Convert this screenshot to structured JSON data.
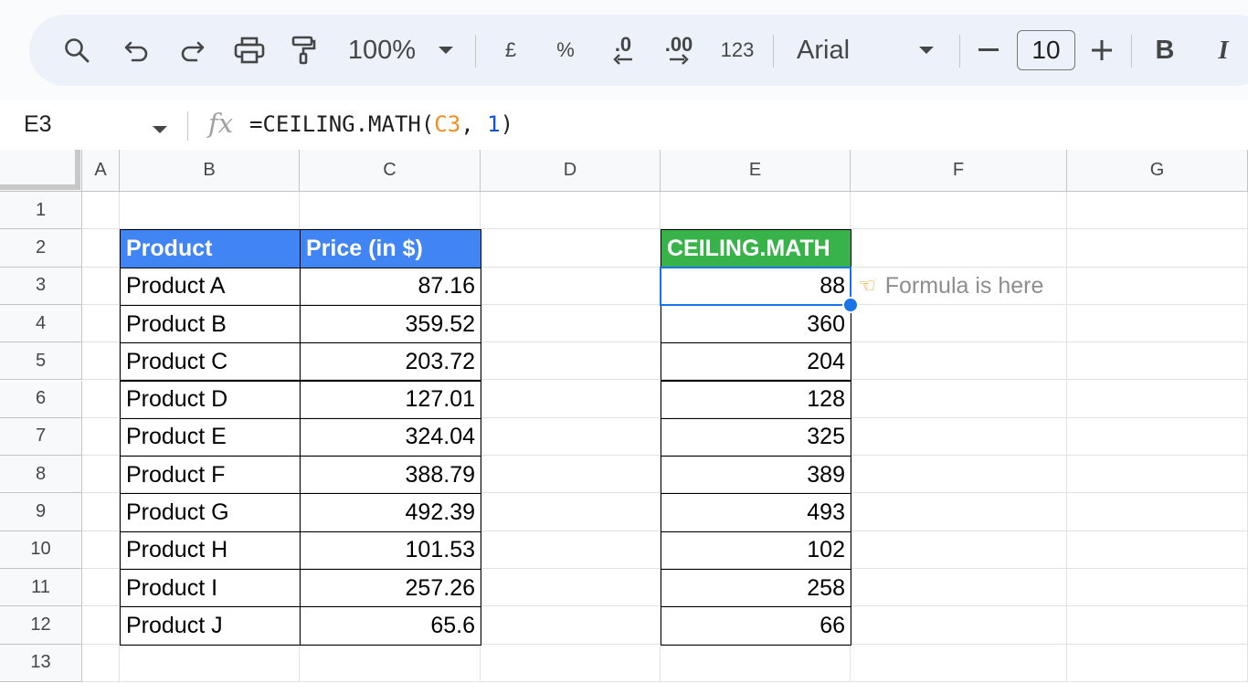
{
  "toolbar": {
    "zoom": "100%",
    "currency_symbol": "£",
    "percent_symbol": "%",
    "decrease_decimal": ".0",
    "increase_decimal": ".00",
    "number_format": "123",
    "font_family": "Arial",
    "font_size": "10",
    "bold": "B",
    "italic": "I",
    "icons": [
      "search-icon",
      "undo-icon",
      "redo-icon",
      "print-icon",
      "paint-format-icon",
      "chevron-down-icon",
      "minus-icon",
      "plus-icon"
    ]
  },
  "formula_bar": {
    "name_box": "E3",
    "fx_label": "fx",
    "formula_prefix": "=CEILING.MATH(",
    "formula_ref": "C3",
    "formula_sep": ", ",
    "formula_arg": "1",
    "formula_suffix": ")"
  },
  "columns": [
    "A",
    "B",
    "C",
    "D",
    "E",
    "F",
    "G"
  ],
  "rows": [
    "1",
    "2",
    "3",
    "4",
    "5",
    "6",
    "7",
    "8",
    "9",
    "10",
    "11",
    "12",
    "13"
  ],
  "table": {
    "header_product": "Product",
    "header_price": "Price (in $)",
    "products": [
      "Product A",
      "Product B",
      "Product C",
      "Product D",
      "Product E",
      "Product F",
      "Product G",
      "Product H",
      "Product I",
      "Product J"
    ],
    "prices": [
      "87.16",
      "359.52",
      "203.72",
      "127.01",
      "324.04",
      "388.79",
      "492.39",
      "101.53",
      "257.26",
      "65.6"
    ]
  },
  "result": {
    "header": "CEILING.MATH",
    "values": [
      "88",
      "360",
      "204",
      "128",
      "325",
      "389",
      "493",
      "102",
      "258",
      "66"
    ]
  },
  "annotation": {
    "hand_icon": "pointing-hand-icon",
    "text": "Formula is here"
  },
  "colors": {
    "product_header_bg": "#4185f4",
    "result_header_bg": "#38b34a",
    "selection": "#1a73e8",
    "formula_ref": "#ee8f20",
    "formula_number": "#1155cc"
  }
}
